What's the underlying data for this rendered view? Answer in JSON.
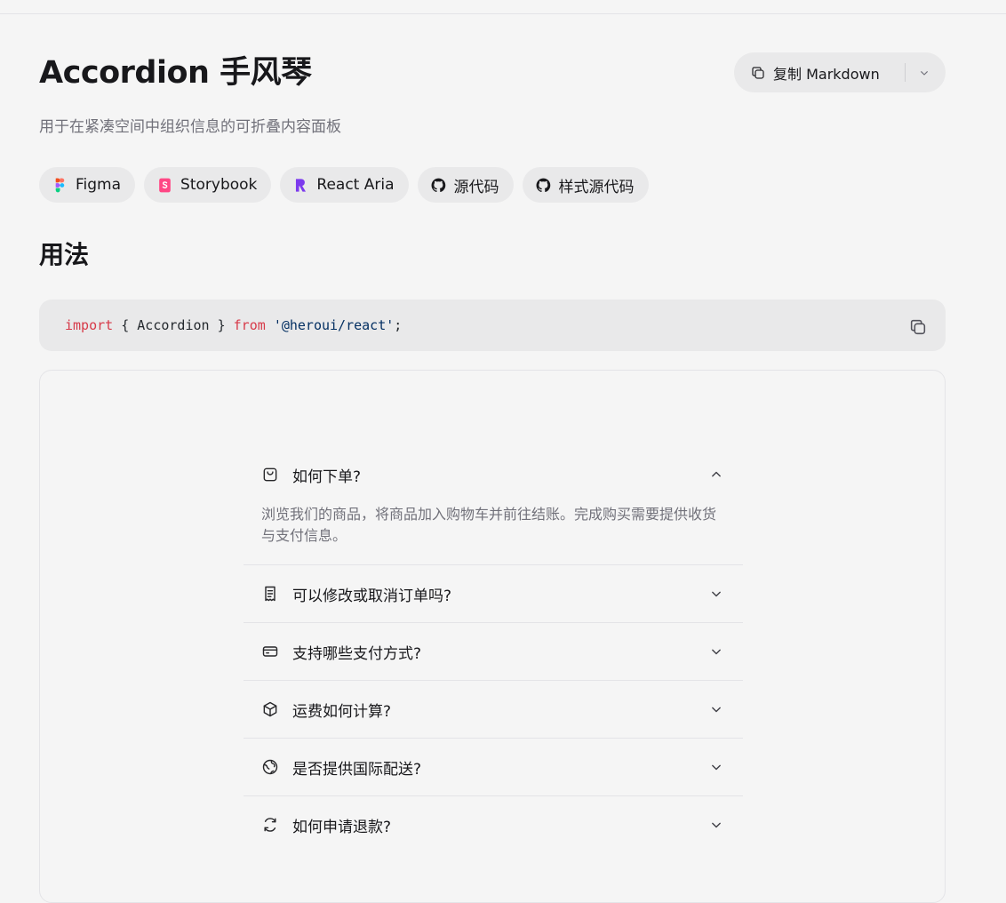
{
  "header": {
    "title": "Accordion 手风琴",
    "subtitle": "用于在紧凑空间中组织信息的可折叠内容面板",
    "copy_markdown_label": "复制 Markdown"
  },
  "links": [
    {
      "label": "Figma",
      "icon": "figma-icon"
    },
    {
      "label": "Storybook",
      "icon": "storybook-icon"
    },
    {
      "label": "React Aria",
      "icon": "react-aria-icon"
    },
    {
      "label": "源代码",
      "icon": "github-icon"
    },
    {
      "label": "样式源代码",
      "icon": "github-icon"
    }
  ],
  "usage": {
    "heading": "用法",
    "code": {
      "kw_import": "import",
      "braces": " { Accordion } ",
      "kw_from": "from",
      "module": "'@heroui/react'",
      "semicolon": ";"
    }
  },
  "accordion": {
    "items": [
      {
        "question": "如何下单?",
        "icon": "shopping-bag-icon",
        "expanded": true,
        "answer": "浏览我们的商品，将商品加入购物车并前往结账。完成购买需要提供收货与支付信息。"
      },
      {
        "question": "可以修改或取消订单吗?",
        "icon": "receipt-icon",
        "expanded": false
      },
      {
        "question": "支持哪些支付方式?",
        "icon": "credit-card-icon",
        "expanded": false
      },
      {
        "question": "运费如何计算?",
        "icon": "box-icon",
        "expanded": false
      },
      {
        "question": "是否提供国际配送?",
        "icon": "globe-icon",
        "expanded": false
      },
      {
        "question": "如何申请退款?",
        "icon": "refresh-icon",
        "expanded": false
      }
    ]
  },
  "colors": {
    "background": "#f5f5f5",
    "chip_bg": "#e9e9ea",
    "text": "#18181b",
    "muted": "#71717a",
    "code_keyword": "#d73a49",
    "code_string": "#032f62",
    "storybook": "#ff4785",
    "react_aria": "#7c3aed"
  }
}
